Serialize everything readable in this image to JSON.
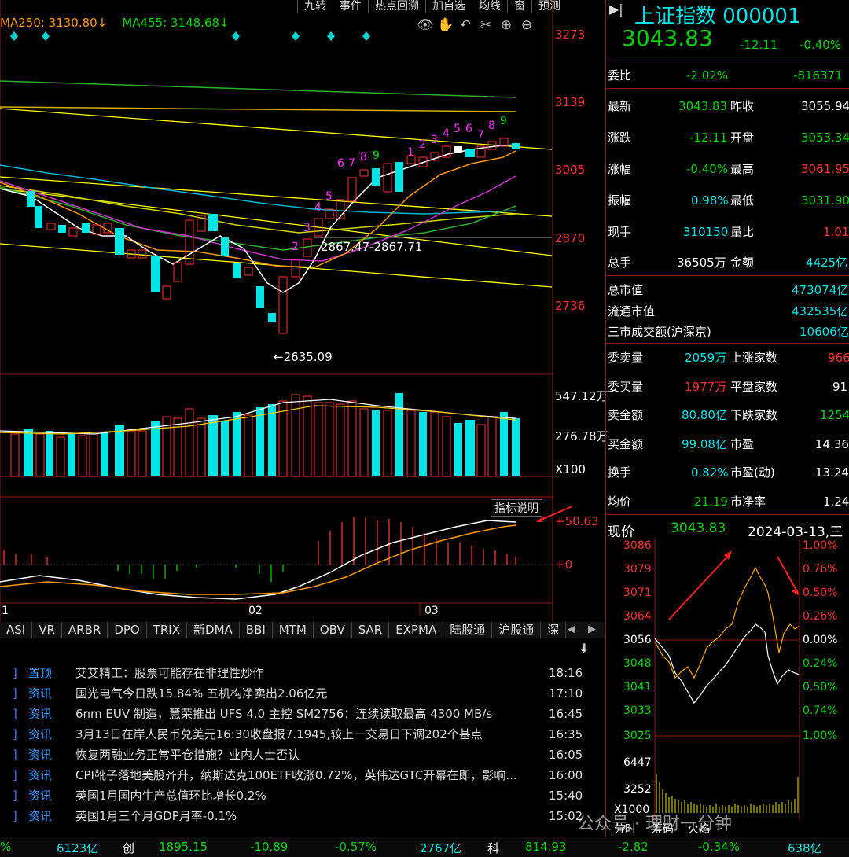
{
  "menu": [
    "九转",
    "事件",
    "热点回溯",
    "加自选",
    "均线",
    "窗",
    "预测"
  ],
  "ma_legend": {
    "ma250": "MA250: 3130.80↓",
    "ma455": "MA455: 3148.68↓"
  },
  "price_axis": [
    "3273",
    "3139",
    "3005",
    "2870",
    "2736"
  ],
  "annotations": {
    "high_line": "2867.47-2867.71",
    "low": "2635.09"
  },
  "td_counts_up": [
    "1",
    "2",
    "3",
    "4",
    "5",
    "6",
    "7",
    "8",
    "9"
  ],
  "td_counts_up2": [
    "1",
    "2",
    "3",
    "4",
    "5",
    "6",
    "7",
    "8",
    "9"
  ],
  "volume_axis": [
    "547.12万",
    "276.78万",
    "X100"
  ],
  "macd": {
    "explain_button": "指标说明",
    "val_top": "+50.63",
    "val_zero": "+0"
  },
  "month_labels": [
    "1",
    "02",
    "03"
  ],
  "indicator_tabs": [
    "ASI",
    "VR",
    "ARBR",
    "DPO",
    "TRIX",
    "新DMA",
    "BBI",
    "MTM",
    "OBV",
    "SAR",
    "EXPMA",
    "陆股通",
    "沪股通",
    "深"
  ],
  "news": [
    {
      "tag": "置顶",
      "title": "艾艾精工：股票可能存在非理性炒作",
      "time": "18:16"
    },
    {
      "tag": "资讯",
      "title": "国光电气今日跌15.84% 五机构净卖出2.06亿元",
      "time": "17:10"
    },
    {
      "tag": "资讯",
      "title": "6nm EUV 制造，慧荣推出 UFS 4.0 主控 SM2756：连续读取最高 4300 MB/s",
      "time": "16:45"
    },
    {
      "tag": "资讯",
      "title": "3月13日在岸人民币兑美元16:30收盘报7.1945,较上一交易日下调202个基点",
      "time": "16:35"
    },
    {
      "tag": "资讯",
      "title": "恢复两融业务正常平仓措施？业内人士否认",
      "time": "16:05"
    },
    {
      "tag": "资讯",
      "title": "CPI靴子落地美股齐升，纳斯达克100ETF收涨0.72%，英伟达GTC开幕在即，影响...",
      "time": "16:00"
    },
    {
      "tag": "资讯",
      "title": "英国1月国内生产总值环比增长0.2%",
      "time": "15:40"
    },
    {
      "tag": "资讯",
      "title": "英国1月三个月GDP月率-0.1%",
      "time": "15:02"
    }
  ],
  "quote": {
    "name": "上证指数 000001",
    "price": "3043.83",
    "change": "-12.11",
    "change_pct": "-0.40%",
    "weibi_label": "委比",
    "weibi": "-2.02%",
    "weicha": "-816371",
    "rows": [
      {
        "l1": "最新",
        "v1": "3043.83",
        "c1": "green",
        "l2": "昨收",
        "v2": "3055.94",
        "c2": "white"
      },
      {
        "l1": "涨跌",
        "v1": "-12.11",
        "c1": "green",
        "l2": "开盘",
        "v2": "3053.34",
        "c2": "green"
      },
      {
        "l1": "涨幅",
        "v1": "-0.40%",
        "c1": "green",
        "l2": "最高",
        "v2": "3061.95",
        "c2": "red"
      },
      {
        "l1": "振幅",
        "v1": "0.98%",
        "c1": "cyan",
        "l2": "最低",
        "v2": "3031.90",
        "c2": "green"
      },
      {
        "l1": "现手",
        "v1": "310150",
        "c1": "cyan",
        "l2": "量比",
        "v2": "1.01",
        "c2": "red"
      },
      {
        "l1": "总手",
        "v1": "36505万",
        "c1": "white",
        "l2": "金额",
        "v2": "4425亿",
        "c2": "cyan"
      }
    ],
    "mkt": [
      {
        "l": "总市值",
        "v": "473074亿"
      },
      {
        "l": "流通市值",
        "v": "432535亿"
      },
      {
        "l": "三市成交额(沪深京)",
        "v": "10606亿"
      }
    ],
    "rows2": [
      {
        "l1": "委卖量",
        "v1": "2059万",
        "c1": "cyan",
        "l2": "上涨家数",
        "v2": "966",
        "c2": "red"
      },
      {
        "l1": "委买量",
        "v1": "1977万",
        "c1": "red",
        "l2": "平盘家数",
        "v2": "91",
        "c2": "white"
      },
      {
        "l1": "卖金额",
        "v1": "80.80亿",
        "c1": "cyan",
        "l2": "下跌家数",
        "v2": "1254",
        "c2": "green"
      },
      {
        "l1": "买金额",
        "v1": "99.08亿",
        "c1": "cyan",
        "l2": "市盈",
        "v2": "14.36",
        "c2": "white"
      },
      {
        "l1": "换手",
        "v1": "0.82%",
        "c1": "cyan",
        "l2": "市盈(动)",
        "v2": "13.24",
        "c2": "white"
      },
      {
        "l1": "均价",
        "v1": "21.19",
        "c1": "green",
        "l2": "市净率",
        "v2": "1.24",
        "c2": "white"
      }
    ]
  },
  "intraday": {
    "label": "现价",
    "price": "3043.83",
    "date": "2024-03-13,三",
    "left_axis": [
      "3086",
      "3079",
      "3071",
      "3064",
      "3056",
      "3048",
      "3041",
      "3033",
      "3025",
      "6447",
      "3252",
      "X1000"
    ],
    "right_axis": [
      "1.00%",
      "0.76%",
      "0.50%",
      "0.26%",
      "0.00%",
      "0.24%",
      "0.50%",
      "0.74%",
      "1.00%"
    ],
    "tabs": [
      "分时",
      "筹码",
      "火焰"
    ],
    "watermark": "公众号 · 理财一分钟"
  },
  "statusbar": {
    "a_pct": "%",
    "a_amt": "6123亿",
    "chuang": "创",
    "c_price": "1895.15",
    "c_chg": "-10.89",
    "c_pct": "-0.57%",
    "c_amt": "2767亿",
    "ke": "科",
    "k_price": "814.93",
    "k_chg": "-2.82",
    "k_pct": "-0.34%",
    "k_amt": "638亿"
  },
  "colors": {
    "up": "#ff3232",
    "down": "#00e6e6",
    "bg": "#000000",
    "grid": "#8b1a1a"
  }
}
